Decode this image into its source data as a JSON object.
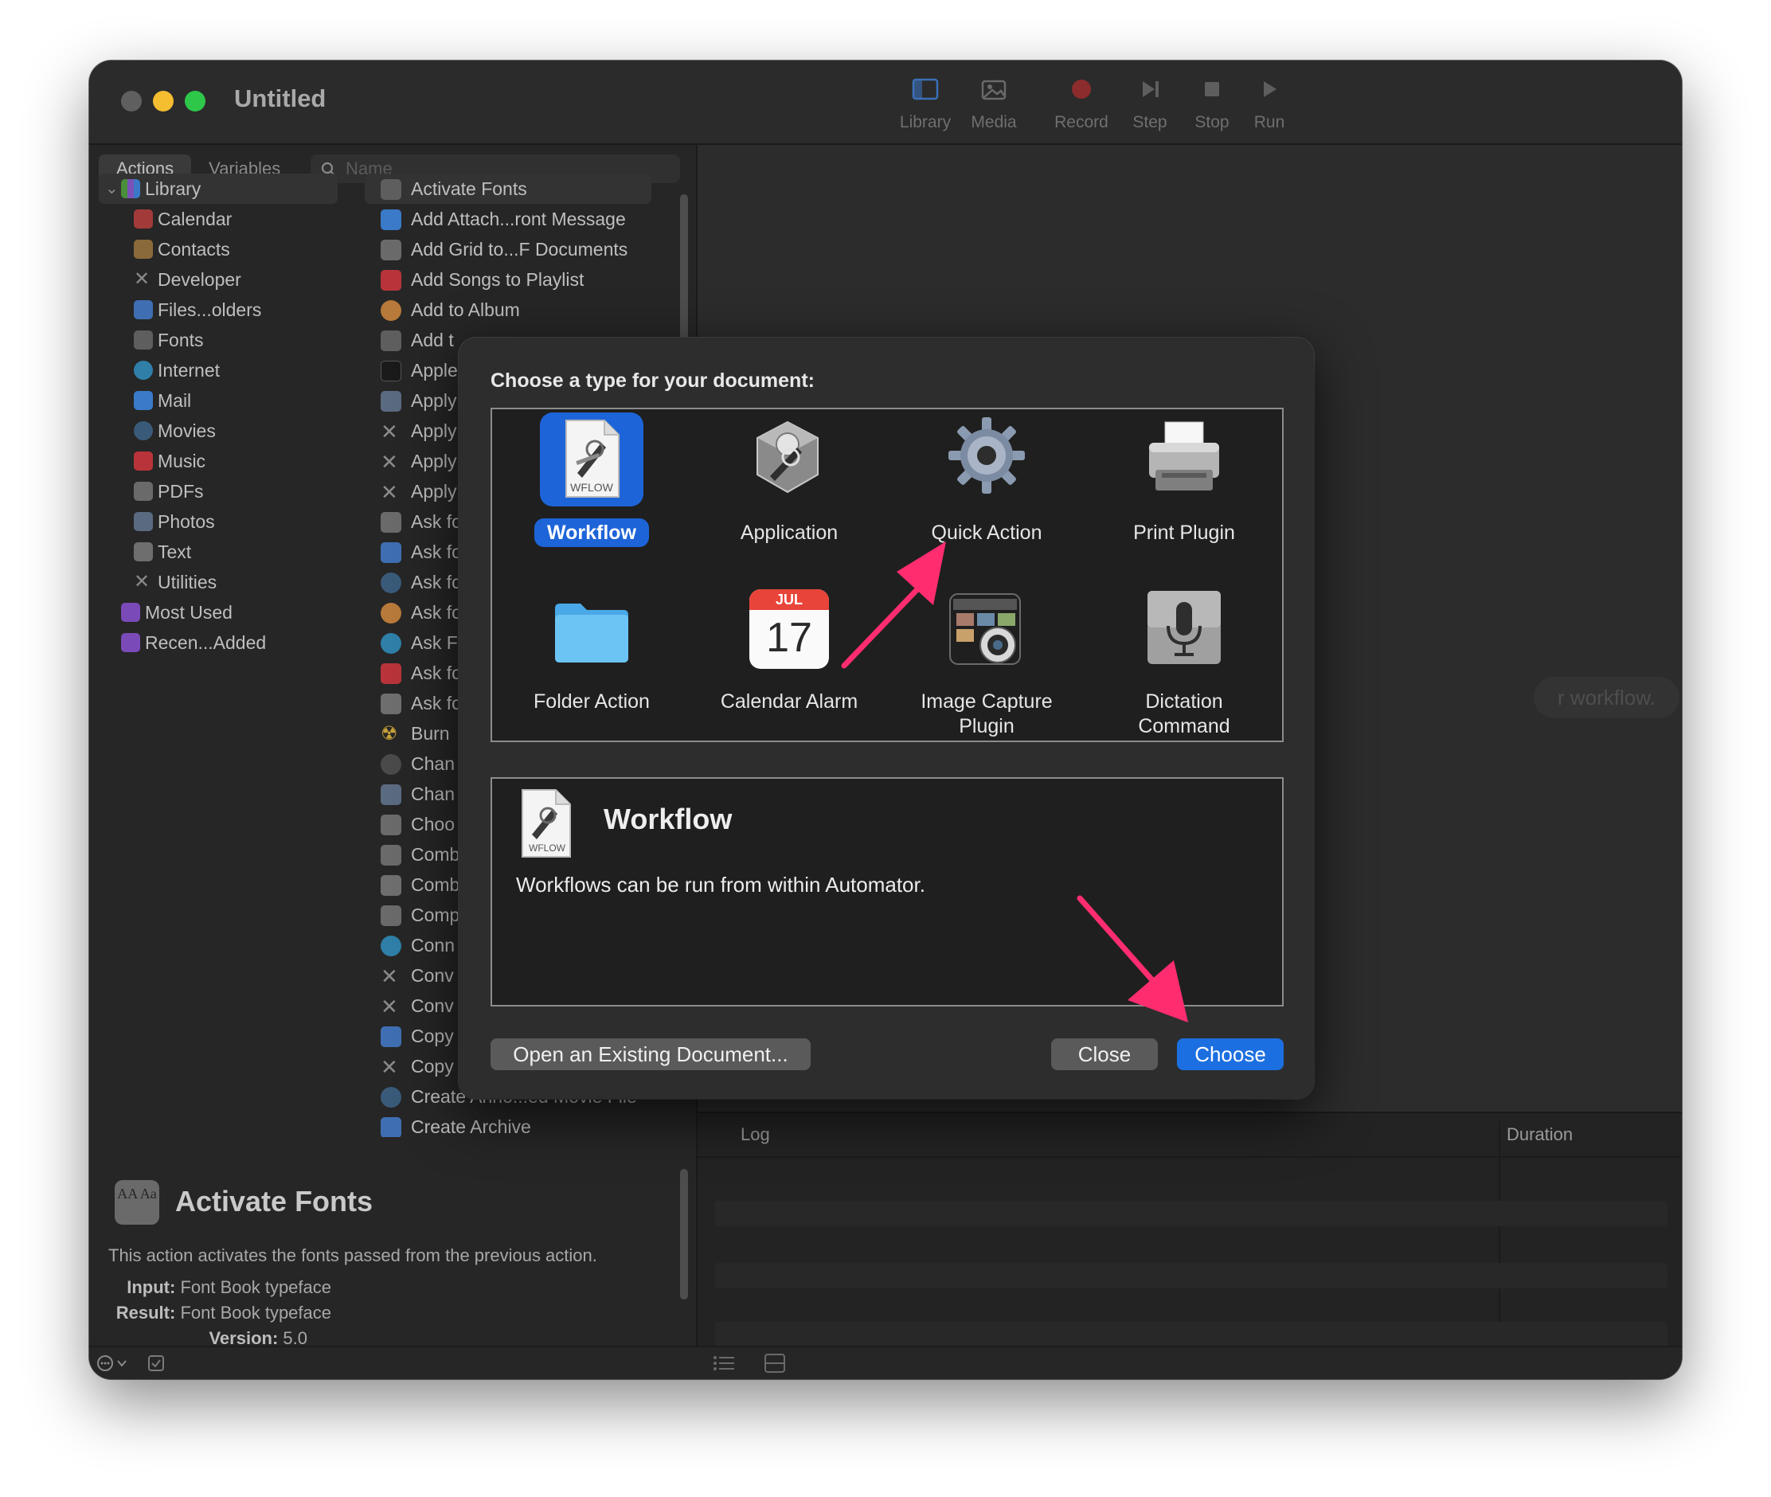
{
  "window": {
    "title": "Untitled",
    "toolbar": [
      {
        "label": "Library",
        "icon": "library-icon"
      },
      {
        "label": "Media",
        "icon": "media-icon"
      },
      {
        "label": "Record",
        "icon": "record-icon"
      },
      {
        "label": "Step",
        "icon": "step-icon"
      },
      {
        "label": "Stop",
        "icon": "stop-icon"
      },
      {
        "label": "Run",
        "icon": "run-icon"
      }
    ]
  },
  "sidebar": {
    "tabs": [
      "Actions",
      "Variables"
    ],
    "search_placeholder": "Name",
    "library": {
      "root": "Library",
      "items": [
        "Calendar",
        "Contacts",
        "Developer",
        "Files...olders",
        "Fonts",
        "Internet",
        "Mail",
        "Movies",
        "Music",
        "PDFs",
        "Photos",
        "Text",
        "Utilities"
      ],
      "extras": [
        "Most Used",
        "Recen...Added"
      ]
    },
    "actions": [
      "Activate Fonts",
      "Add Attach...ront Message",
      "Add Grid to...F Documents",
      "Add Songs to Playlist",
      "Add to Album",
      "Add t",
      "Apple",
      "Apply",
      "Apply",
      "Apply",
      "Apply",
      "Ask fo",
      "Ask fo",
      "Ask fo",
      "Ask fo",
      "Ask F",
      "Ask fo",
      "Ask fo",
      "Burn",
      "Chan",
      "Chan",
      "Choo",
      "Comb",
      "Comb",
      "Comp",
      "Conn",
      "Conv",
      "Conv",
      "Copy",
      "Copy to Clipboard",
      "Create Anno...ed Movie File",
      "Create Archive"
    ]
  },
  "description": {
    "icon_text": "AA Aa",
    "title": "Activate Fonts",
    "text": "This action activates the fonts passed from the previous action.",
    "input_label": "Input:",
    "input_value": "Font Book typeface",
    "result_label": "Result:",
    "result_value": "Font Book typeface",
    "version_label": "Version:",
    "version_value": "5.0"
  },
  "workflow": {
    "hint": "r workflow."
  },
  "log": {
    "col_log": "Log",
    "col_duration": "Duration"
  },
  "dialog": {
    "heading": "Choose a type for your document:",
    "types": [
      {
        "label": "Workflow",
        "icon": "workflow-icon",
        "selected": true
      },
      {
        "label": "Application",
        "icon": "application-icon"
      },
      {
        "label": "Quick Action",
        "icon": "gear-icon"
      },
      {
        "label": "Print Plugin",
        "icon": "printer-icon"
      },
      {
        "label": "Folder Action",
        "icon": "folder-icon"
      },
      {
        "label": "Calendar Alarm",
        "icon": "calendar-icon"
      },
      {
        "label": "Image Capture\nPlugin",
        "icon": "camera-icon"
      },
      {
        "label": "Dictation\nCommand",
        "icon": "microphone-icon"
      }
    ],
    "calendar_month": "JUL",
    "calendar_day": "17",
    "wflow_tag": "WFLOW",
    "info_title": "Workflow",
    "info_text": "Workflows can be run from within Automator.",
    "buttons": {
      "open": "Open an Existing Document...",
      "close": "Close",
      "choose": "Choose"
    }
  },
  "colors": {
    "accent": "#1c6fe0",
    "annotation_arrow": "#ff2d6f"
  }
}
